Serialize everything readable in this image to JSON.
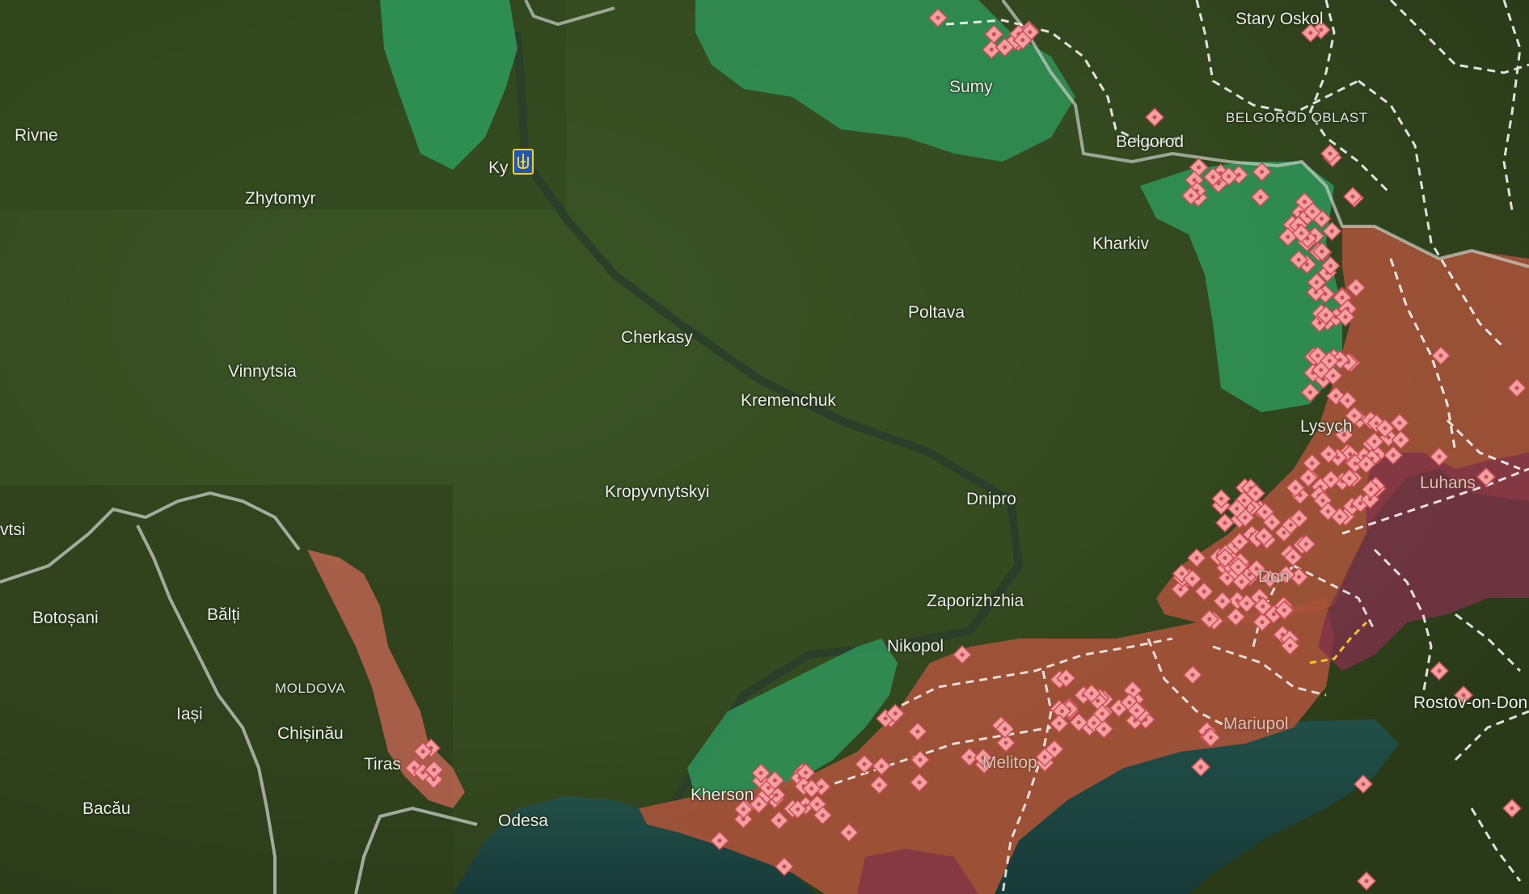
{
  "map": {
    "colors": {
      "terrain": "#33491f",
      "liberated": "#2e9a5c",
      "occupied": "#a8533a",
      "occupied_pre2022": "#7d3248",
      "transnistria": "#c96654",
      "marker_fill": "#f4a0a2",
      "marker_stroke": "#c94d55",
      "border": "#c9cfc6",
      "road": "#ffffff",
      "sea": "#1f4a44"
    },
    "labels": {
      "rivne": "Rivne",
      "kyiv": "Ky",
      "zhytomyr": "Zhytomyr",
      "sumy": "Sumy",
      "stary_oskol": "Stary Oskol",
      "belgorod_oblast": "BELGOROD OBLAST",
      "belgorod": "Belgorod",
      "kharkiv": "Kharkiv",
      "poltava": "Poltava",
      "cherkasy": "Cherkasy",
      "vinnytsia": "Vinnytsia",
      "kremenchuk": "Kremenchuk",
      "kropyvnytskyi": "Kropyvnytskyi",
      "dnipro": "Dnipro",
      "lysychansk": "Lysych",
      "luhansk": "Luhans",
      "donetsk": "Don",
      "zaporizhzhia": "Zaporizhzhia",
      "nikopol": "Nikopol",
      "mariupol": "Mariupol",
      "rostov": "Rostov-on-Don",
      "melitopol": "Melitop",
      "kherson": "Kherson",
      "odesa": "Odesa",
      "tiraspol": "Tiras",
      "chisinau": "Chișinău",
      "moldova": "MOLDOVA",
      "iasi": "Iași",
      "balti": "Bălți",
      "botosani": "Botoșani",
      "bacau": "Bacău",
      "chernivtsi": "vtsi"
    },
    "icons": {
      "capital": "ukraine-trident-icon",
      "event": "explosion-marker-icon"
    }
  }
}
